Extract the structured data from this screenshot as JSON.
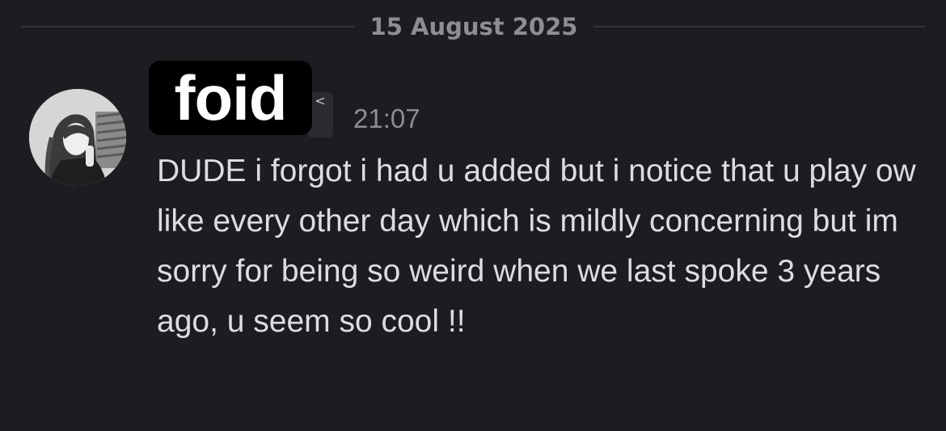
{
  "date_divider": {
    "label": "15 August 2025"
  },
  "message": {
    "author": "foid",
    "timestamp": "21:07",
    "text": "DUDE i forgot i had u added but i notice that u play ow like every other day which is mildly concerning but im sorry for being so weird when we last spoke 3 years ago, u seem so cool !!",
    "role_chip_glyph": "<"
  },
  "colors": {
    "background": "#1c1c21",
    "divider_line": "#33343b",
    "muted_text": "#8c8d95",
    "message_text": "#dcdde2"
  }
}
